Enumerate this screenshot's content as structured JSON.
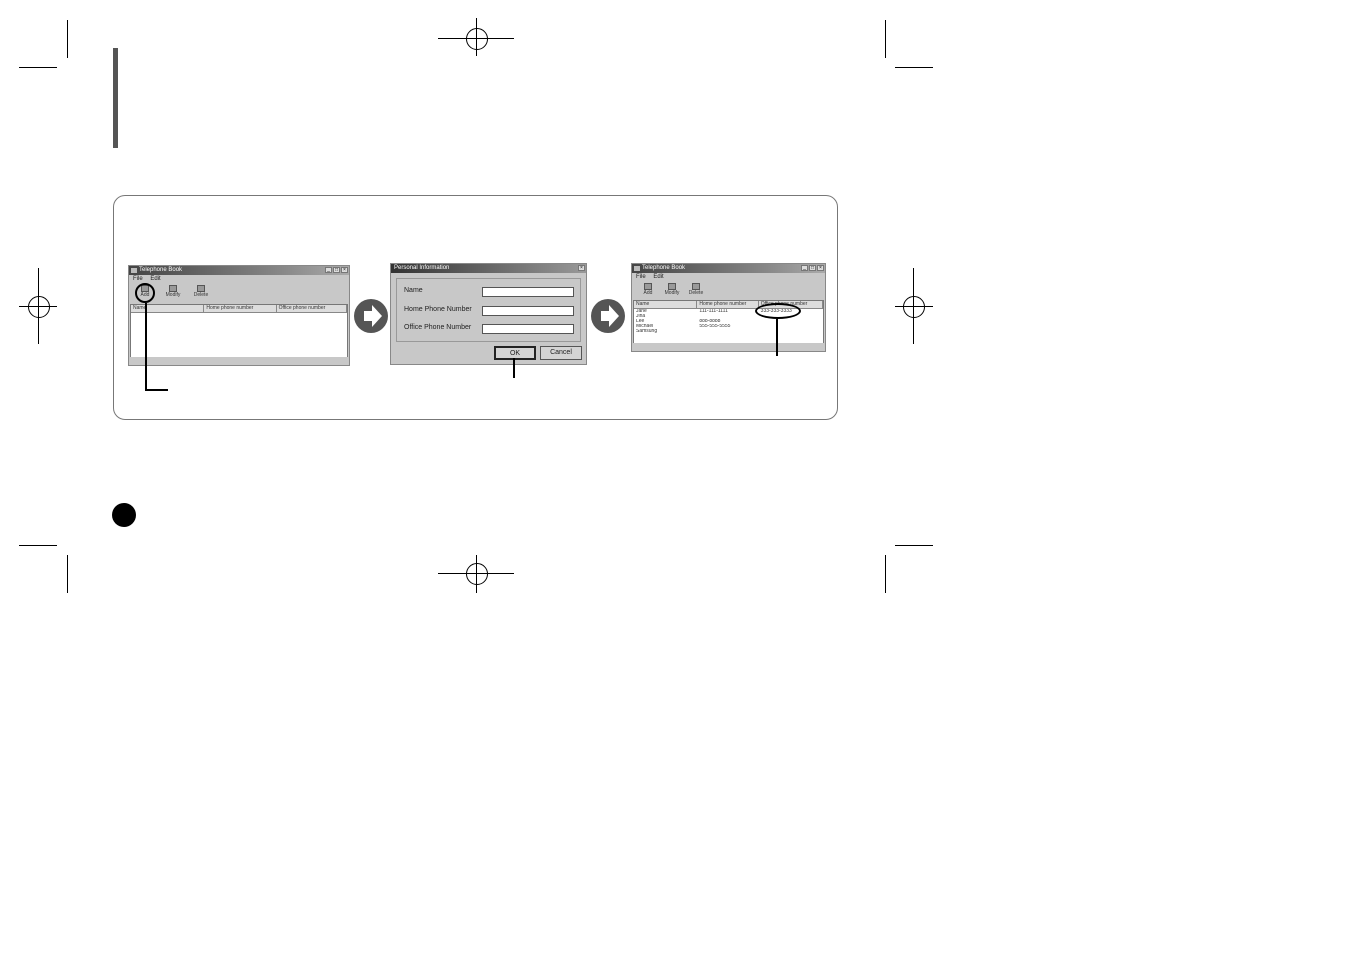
{
  "colors": {
    "frame": "#777777",
    "accent_bar": "#555555",
    "badge": "#000000"
  },
  "window1": {
    "title": "Telephone Book",
    "menu": [
      "File",
      "Edit"
    ],
    "toolbar": [
      "Add",
      "Modify",
      "Delete"
    ],
    "columns": [
      "Name",
      "Home phone number",
      "Office phone number"
    ]
  },
  "dialog": {
    "title": "Personal Information",
    "fields": [
      "Name",
      "Home Phone Number",
      "Office Phone Number"
    ],
    "ok_label": "OK",
    "cancel_label": "Cancel"
  },
  "window2": {
    "title": "Telephone Book",
    "menu": [
      "File",
      "Edit"
    ],
    "toolbar": [
      "Add",
      "Modify",
      "Delete"
    ],
    "columns": [
      "Name",
      "Home phone number",
      "Office phone number"
    ],
    "rows": [
      {
        "name": "Jane",
        "home": "111-111-1111",
        "office": "333-333-3333"
      },
      {
        "name": "Jina",
        "home": "",
        "office": ""
      },
      {
        "name": "Lee",
        "home": "888-8888",
        "office": ""
      },
      {
        "name": "Michael",
        "home": "555-555-5555",
        "office": ""
      },
      {
        "name": "Samsung",
        "home": "",
        "office": ""
      }
    ]
  }
}
